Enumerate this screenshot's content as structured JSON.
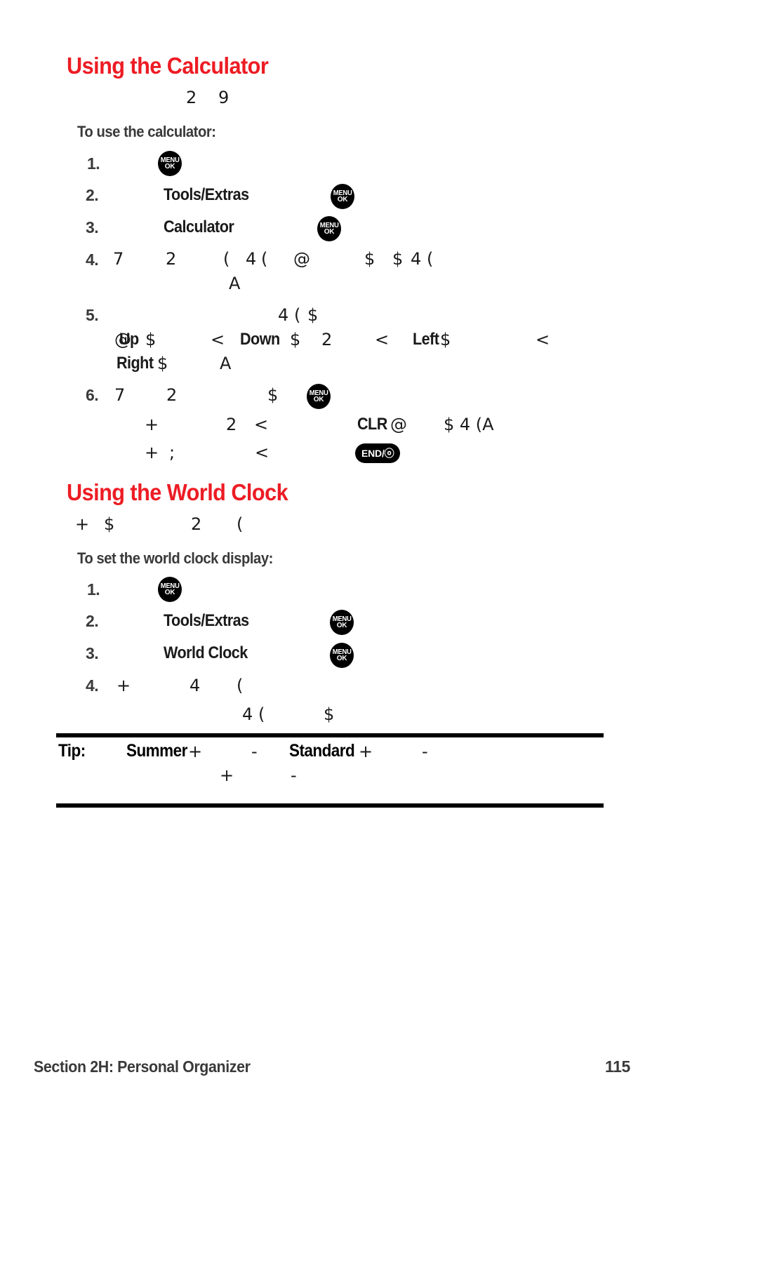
{
  "page": {
    "number": "115",
    "footer_section": "Section 2H: Personal Organizer",
    "accent_color": "#ed1c24",
    "text_color": "#231f20"
  },
  "calculator": {
    "heading": "Using the Calculator",
    "intro_glyphs": [
      "2",
      "9"
    ],
    "subhead": "To use the calculator:",
    "steps": [
      {
        "number": "1.",
        "parts": [],
        "icons": [
          "menu-ok-key"
        ]
      },
      {
        "number": "2.",
        "label": "Tools/Extras",
        "icons": [
          "menu-ok-key"
        ]
      },
      {
        "number": "3.",
        "label": "Calculator",
        "icons": [
          "menu-ok-key"
        ]
      },
      {
        "number": "4.",
        "glyphs": [
          "7",
          "2",
          "(",
          "4",
          "(",
          "@",
          "$",
          "$",
          "4",
          "("
        ],
        "glyphs_line2": [
          "A"
        ]
      },
      {
        "number": "5.",
        "glyphs": [
          "4",
          "(",
          "$"
        ],
        "nav_line": {
          "at_symbol": "@",
          "up_label": "Up",
          "up_glyph": "$",
          "sep1": "<",
          "down_label": "Down",
          "down_glyph": "$",
          "down_extra": "2",
          "sep2": "<",
          "left_label": "Left",
          "left_glyph": "$",
          "sep3": "<"
        },
        "right_line": {
          "right_label": "Right",
          "right_glyph": "$",
          "trailing": "A"
        }
      },
      {
        "number": "6.",
        "glyphs": [
          "7",
          "2",
          "$"
        ],
        "icons": [
          "menu-ok-key"
        ],
        "sub_line_1": {
          "glyphs": [
            "+",
            "2",
            "<"
          ],
          "clr_label": "CLR",
          "clr_glyph": "@",
          "trailing": "$ 4 (A"
        },
        "sub_line_2": {
          "glyphs": [
            "+",
            ";",
            "<"
          ],
          "icon": "end-power-key"
        }
      }
    ]
  },
  "world_clock": {
    "heading": "Using the World Clock",
    "intro_glyphs": [
      "+",
      "$",
      "2",
      "("
    ],
    "subhead": "To set the world clock display:",
    "steps": [
      {
        "number": "1.",
        "icons": [
          "menu-ok-key"
        ]
      },
      {
        "number": "2.",
        "label": "Tools/Extras",
        "icons": [
          "menu-ok-key"
        ]
      },
      {
        "number": "3.",
        "label": "World Clock",
        "icons": [
          "menu-ok-key"
        ]
      },
      {
        "number": "4.",
        "glyphs": [
          "+",
          "4",
          "("
        ],
        "glyphs_line2": [
          "4",
          "(",
          "$"
        ]
      }
    ]
  },
  "tip": {
    "label": "Tip:",
    "line1": {
      "summer_label": "Summer",
      "summer_glyph": "+",
      "dash1": "-",
      "standard_label": "Standard",
      "standard_glyph": "+",
      "dash2": "-"
    },
    "line2": {
      "plus": "+",
      "dash": "-"
    }
  },
  "keys": {
    "menu_ok": {
      "line1": "MENU",
      "line2": "OK",
      "name": "menu-ok-key"
    },
    "end_power": {
      "label": "END/ⓞ",
      "name": "end-power-key"
    }
  }
}
